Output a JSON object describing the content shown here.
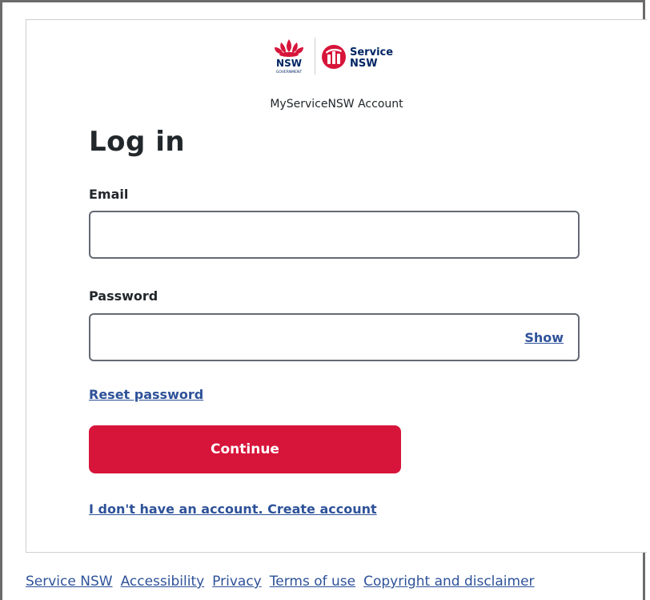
{
  "brand": {
    "nsw_text": "NSW",
    "nsw_gov_text": "GOVERNMENT",
    "service_text": "Service",
    "service_nsw_text": "NSW",
    "account_title": "MyServiceNSW Account"
  },
  "login": {
    "heading": "Log in",
    "email_label": "Email",
    "email_value": "",
    "password_label": "Password",
    "password_value": "",
    "show_label": "Show",
    "reset_label": "Reset password",
    "continue_label": "Continue",
    "create_label": "I don't have an account. Create account"
  },
  "footer": {
    "links": [
      "Service NSW",
      "Accessibility",
      "Privacy",
      "Terms of use",
      "Copyright and disclaimer"
    ]
  },
  "colors": {
    "primary_red": "#d7153a",
    "link_blue": "#2e5299",
    "text_dark": "#22272b",
    "nsw_navy": "#002664"
  },
  "icons": [
    "nsw-waratah-logo-icon",
    "service-nsw-logo-icon"
  ]
}
